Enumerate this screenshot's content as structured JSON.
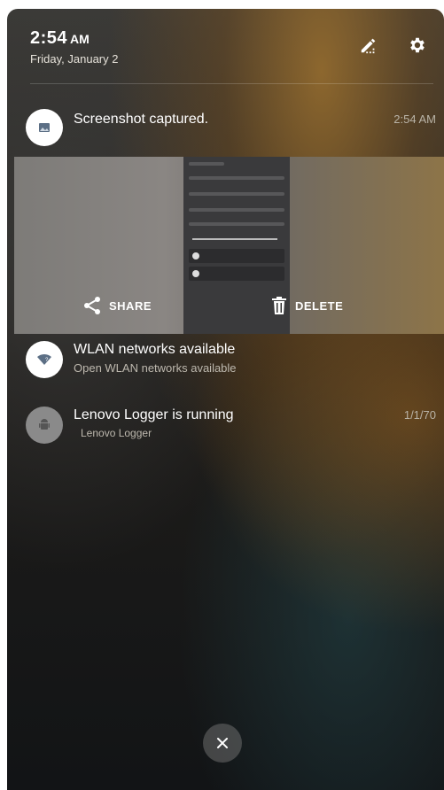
{
  "header": {
    "time": "2:54",
    "ampm": "AM",
    "date": "Friday, January 2",
    "edit_icon": "edit-pencil-icon",
    "settings_icon": "gear-icon"
  },
  "notifications": [
    {
      "title": "Screenshot captured.",
      "time": "2:54 AM",
      "icon": "image-icon",
      "actions": [
        {
          "label": "SHARE",
          "icon": "share-icon"
        },
        {
          "label": "DELETE",
          "icon": "trash-icon"
        }
      ]
    },
    {
      "title": "WLAN networks available",
      "subtitle": "Open WLAN networks available",
      "icon": "wifi-icon"
    },
    {
      "title": "Lenovo Logger is running",
      "subtitle": "Lenovo Logger",
      "time": "1/1/70",
      "icon": "android-icon"
    }
  ],
  "footer": {
    "close_icon": "close-icon"
  },
  "colors": {
    "text": "#ffffff",
    "subtext": "#bdb8ae",
    "accent_orange": "#a8742c"
  }
}
